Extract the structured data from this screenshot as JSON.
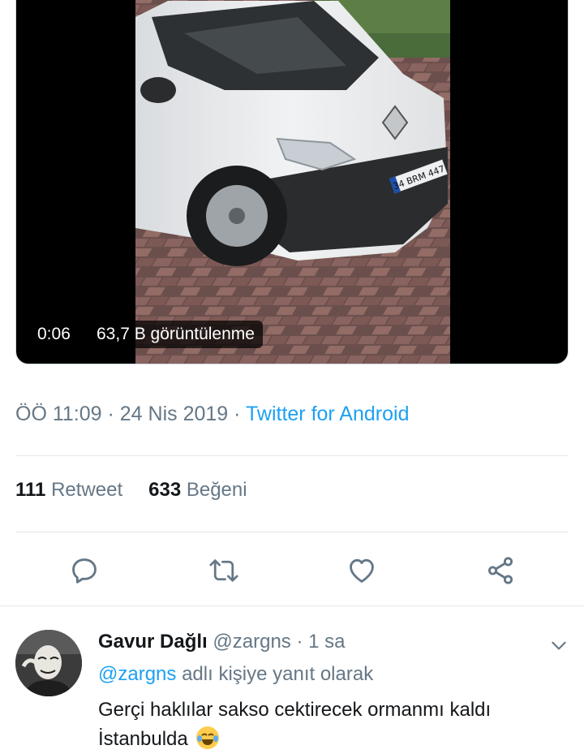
{
  "video": {
    "duration": "0:06",
    "views": "63,7 B görüntülenme",
    "plate_text": "34 BRM 447"
  },
  "tweet_meta": {
    "time": "ÖÖ 11:09",
    "separator": "·",
    "date": "24 Nis 2019",
    "source": "Twitter for Android"
  },
  "stats": {
    "retweet_count": "111",
    "retweet_label": "Retweet",
    "like_count": "633",
    "like_label": "Beğeni"
  },
  "actions": [
    {
      "name": "reply",
      "icon": "speech-bubble-icon"
    },
    {
      "name": "retweet",
      "icon": "retweet-arrows-icon"
    },
    {
      "name": "like",
      "icon": "heart-icon"
    },
    {
      "name": "share",
      "icon": "share-nodes-icon"
    }
  ],
  "reply": {
    "display_name": "Gavur Dağlı",
    "handle": "@zargns",
    "separator": "·",
    "time": "1 sa",
    "replying_to_handle": "@zargns",
    "replying_to_suffix": "adlı kişiye yanıt olarak",
    "text": "Gerçi haklılar sakso cektirecek ormanmı kaldı İstanbulda",
    "emoji": "😂"
  },
  "colors": {
    "link": "#1da1f2",
    "secondary_text": "#657786",
    "icon": "#657786",
    "divider": "#e1e8ed"
  }
}
